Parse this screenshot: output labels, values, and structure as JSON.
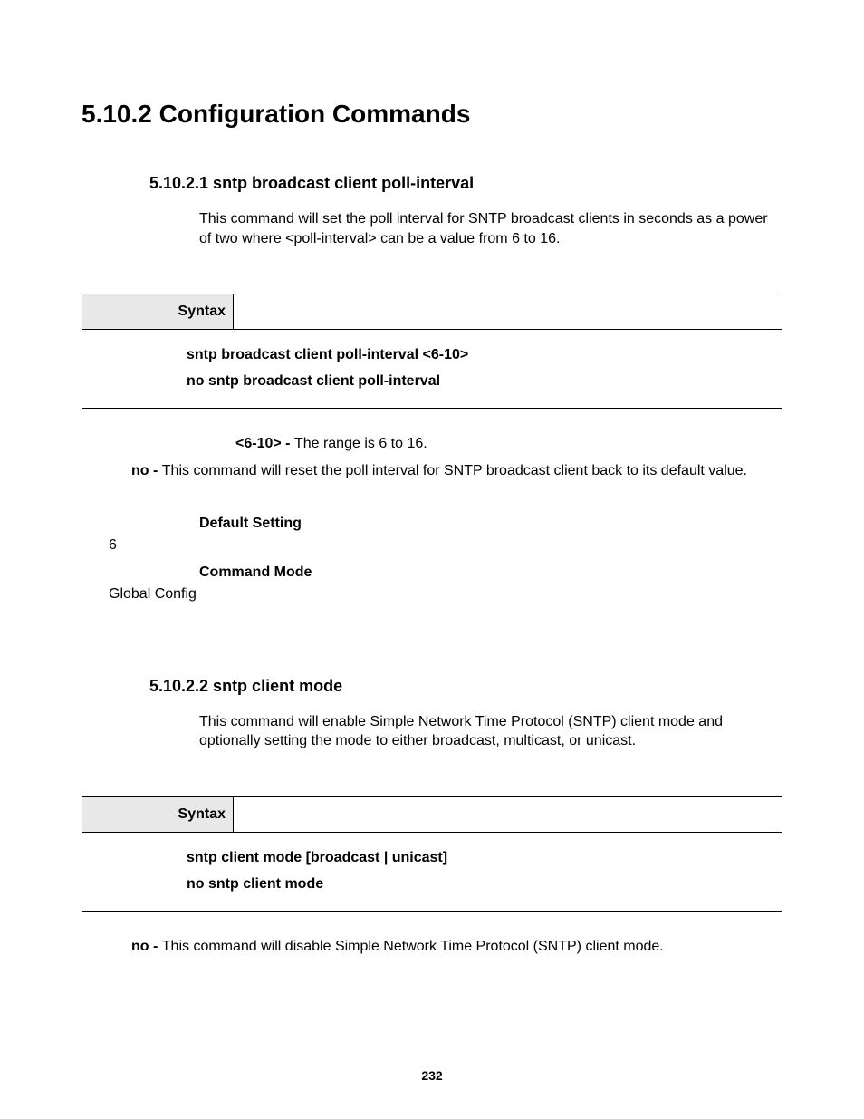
{
  "heading": "5.10.2 Configuration Commands",
  "sec1": {
    "title": "5.10.2.1 sntp broadcast client poll-interval",
    "desc": "This command will set the poll interval for SNTP broadcast clients in seconds as a power of two where <poll-interval> can be a value from 6 to 16.",
    "syntax_label": "Syntax",
    "syntax_line1": "sntp broadcast client poll-interval <6-10>",
    "syntax_line2": "no sntp broadcast client poll-interval",
    "param_label": "<6-10> - ",
    "param_text": "The range is 6 to 16.",
    "no_label": "no - ",
    "no_text": "This command will reset the poll interval for SNTP broadcast client back to its default value.",
    "default_label": "Default Setting",
    "default_value": "6",
    "mode_label": "Command Mode",
    "mode_value": "Global Config"
  },
  "sec2": {
    "title": "5.10.2.2 sntp client mode",
    "desc": "This command will enable Simple Network Time Protocol (SNTP) client mode and optionally setting the mode to either broadcast, multicast, or unicast.",
    "syntax_label": "Syntax",
    "syntax_line1": "sntp client mode [broadcast | unicast]",
    "syntax_line2": "no sntp client mode",
    "no_label": "no - ",
    "no_text": "This command will disable Simple Network Time Protocol (SNTP) client mode."
  },
  "page_number": "232"
}
